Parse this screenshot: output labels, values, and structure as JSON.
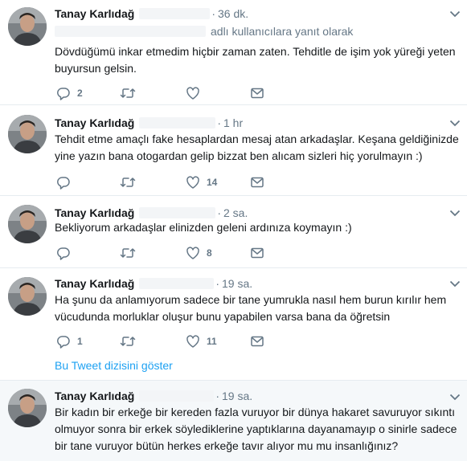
{
  "colors": {
    "name": "#14171a",
    "meta": "#657786",
    "link": "#1da1f2",
    "divider": "#e6ecf0"
  },
  "icons": [
    "reply-icon",
    "retweet-icon",
    "like-icon",
    "message-icon",
    "chevron-down-icon"
  ],
  "tweets": [
    {
      "author": "Tanay Karlıdağ",
      "separator": "·",
      "time": "36 dk.",
      "reply_to_suffix": "adlı kullanıcılara yanıt olarak",
      "text": "Dövdüğümü inkar etmedim hiçbir zaman zaten. Tehditle de işim yok yüreği yeten buyursun gelsin.",
      "reply_count": "2",
      "retweet_count": "",
      "like_count": ""
    },
    {
      "author": "Tanay Karlıdağ",
      "separator": "·",
      "time": "1 hr",
      "text": "Tehdit etme amaçlı fake hesaplardan mesaj atan arkadaşlar. Keşana geldiğinizde yine yazın bana otogardan gelip bizzat ben alıcam sizleri hiç yorulmayın :)",
      "reply_count": "",
      "retweet_count": "",
      "like_count": "14"
    },
    {
      "author": "Tanay Karlıdağ",
      "separator": "·",
      "time": "2 sa.",
      "text": "Bekliyorum arkadaşlar elinizden geleni ardınıza koymayın :)",
      "reply_count": "",
      "retweet_count": "",
      "like_count": "8"
    },
    {
      "author": "Tanay Karlıdağ",
      "separator": "·",
      "time": "19 sa.",
      "text": "Ha şunu da anlamıyorum sadece bir tane yumrukla nasıl hem burun kırılır hem vücudunda morluklar oluşur bunu yapabilen varsa bana da öğretsin",
      "reply_count": "1",
      "retweet_count": "",
      "like_count": "11",
      "show_thread": "Bu Tweet dizisini göster"
    },
    {
      "author": "Tanay Karlıdağ",
      "separator": "·",
      "time": "19 sa.",
      "text": "Bir kadın bir erkeğe bir kereden fazla vuruyor bir dünya hakaret savuruyor sıkıntı olmuyor sonra bir erkek söylediklerine yaptıklarına dayanamayıp o sinirle sadece bir tane vuruyor bütün herkes erkeğe tavır alıyor mu mu insanlığınız?"
    }
  ]
}
